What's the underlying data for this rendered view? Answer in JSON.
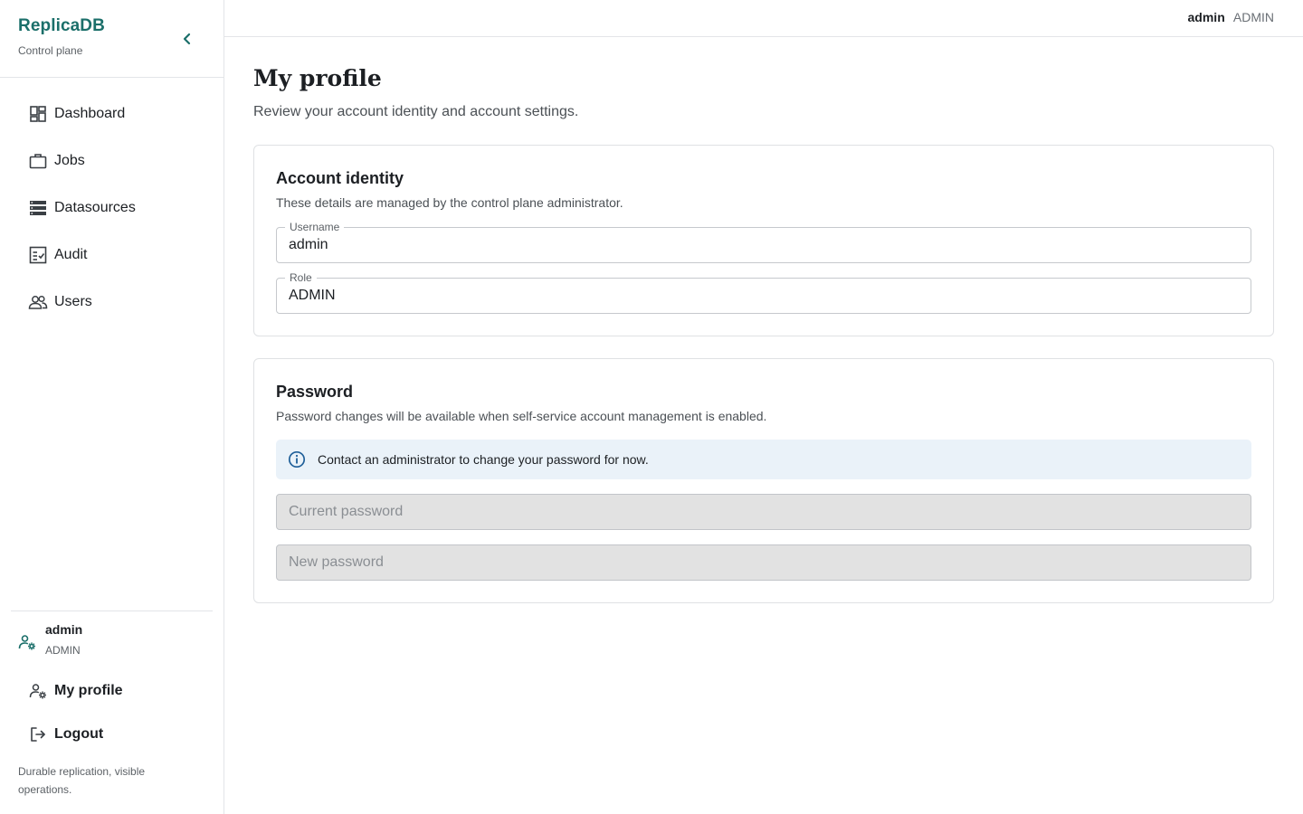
{
  "brand": {
    "title": "ReplicaDB",
    "subtitle": "Control plane"
  },
  "nav": {
    "items": [
      {
        "label": "Dashboard",
        "icon": "dashboard-icon"
      },
      {
        "label": "Jobs",
        "icon": "briefcase-icon"
      },
      {
        "label": "Datasources",
        "icon": "storage-icon"
      },
      {
        "label": "Audit",
        "icon": "checklist-icon"
      },
      {
        "label": "Users",
        "icon": "users-icon"
      }
    ]
  },
  "sidebar_user": {
    "name": "admin",
    "role": "ADMIN"
  },
  "sidebar_links": {
    "profile": "My profile",
    "logout": "Logout"
  },
  "tagline": "Durable replication, visible operations.",
  "topbar": {
    "user_name": "admin",
    "user_role": "ADMIN"
  },
  "page": {
    "title": "My profile",
    "subtitle": "Review your account identity and account settings."
  },
  "identity": {
    "title": "Account identity",
    "description": "These details are managed by the control plane administrator.",
    "username_label": "Username",
    "username_value": "admin",
    "role_label": "Role",
    "role_value": "ADMIN"
  },
  "password": {
    "title": "Password",
    "description": "Password changes will be available when self-service account management is enabled.",
    "info": "Contact an administrator to change your password for now.",
    "current_placeholder": "Current password",
    "new_placeholder": "New password"
  },
  "colors": {
    "brand": "#1b6f6a",
    "info_bg": "#eaf2f9",
    "info_icon": "#1f5f99",
    "disabled_input": "#e2e2e2"
  }
}
